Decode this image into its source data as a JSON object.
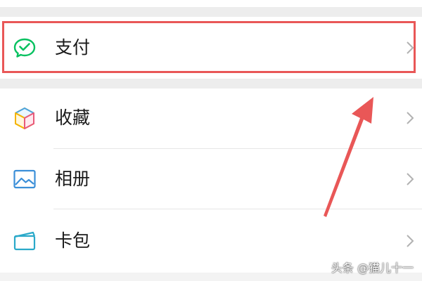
{
  "menu": {
    "items": [
      {
        "label": "支付",
        "icon": "wechat-pay-icon"
      },
      {
        "label": "收藏",
        "icon": "favorites-cube-icon"
      },
      {
        "label": "相册",
        "icon": "album-image-icon"
      },
      {
        "label": "卡包",
        "icon": "card-wallet-icon"
      }
    ]
  },
  "annotation": {
    "highlight_color": "#e95757",
    "arrow_color": "#e95757"
  },
  "watermark": {
    "text": "头条 @猫儿十一"
  },
  "colors": {
    "pay_green": "#07c160",
    "separator_gray": "#ededed",
    "text": "#1a1a1a",
    "chevron": "#b2b2b2"
  }
}
